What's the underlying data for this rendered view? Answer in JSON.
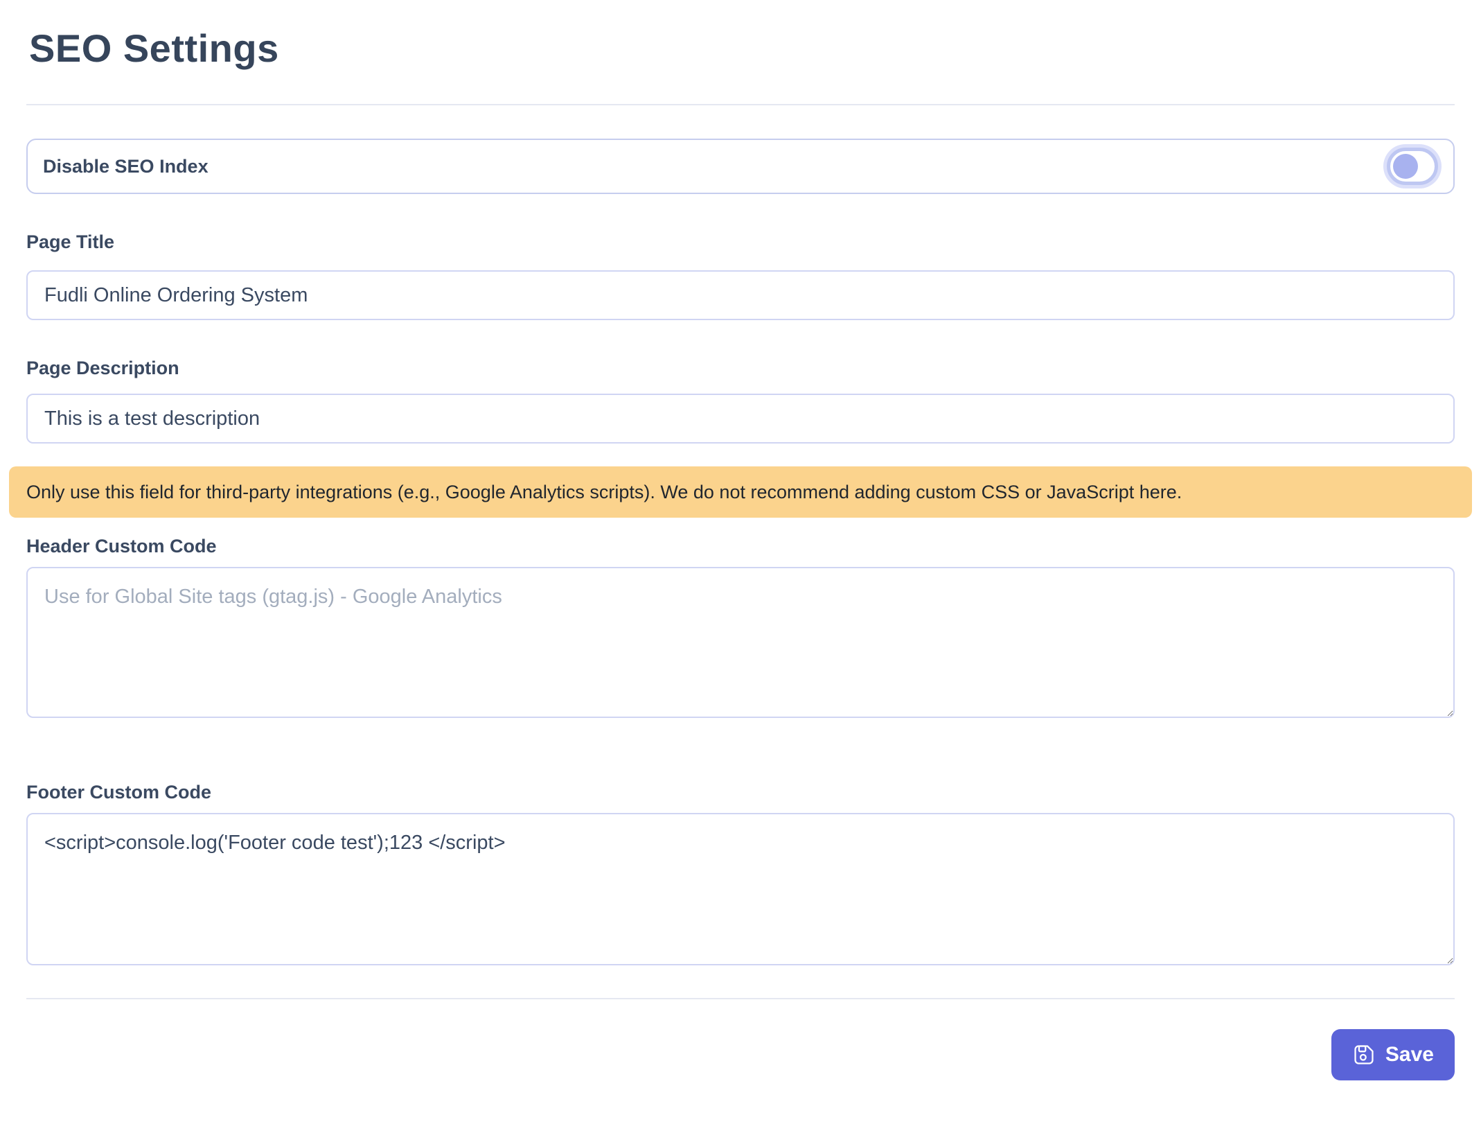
{
  "header": {
    "title": "SEO Settings"
  },
  "seo_index_toggle": {
    "label": "Disable SEO Index",
    "state": "off"
  },
  "page_title_field": {
    "label": "Page Title",
    "value": "Fudli Online Ordering System"
  },
  "page_description_field": {
    "label": "Page Description",
    "value": "This is a test description"
  },
  "warning_banner": {
    "text": "Only use this field for third-party integrations (e.g., Google Analytics scripts). We do not recommend adding custom CSS or JavaScript here."
  },
  "header_code_field": {
    "label": "Header Custom Code",
    "placeholder": "Use for Global Site tags (gtag.js) - Google Analytics"
  },
  "footer_code_field": {
    "label": "Footer Custom Code",
    "value": "<script>console.log('Footer code test');123 </script>"
  },
  "actions": {
    "save_label": "Save",
    "save_icon": "floppy-disk-icon"
  },
  "colors": {
    "accent": "#5a63d8",
    "warning_bg": "#fbd38d",
    "field_border": "#d0d5f3",
    "text": "#3a4961",
    "toggle_track": "#bec7f2",
    "toggle_knob": "#a8b2ef"
  }
}
